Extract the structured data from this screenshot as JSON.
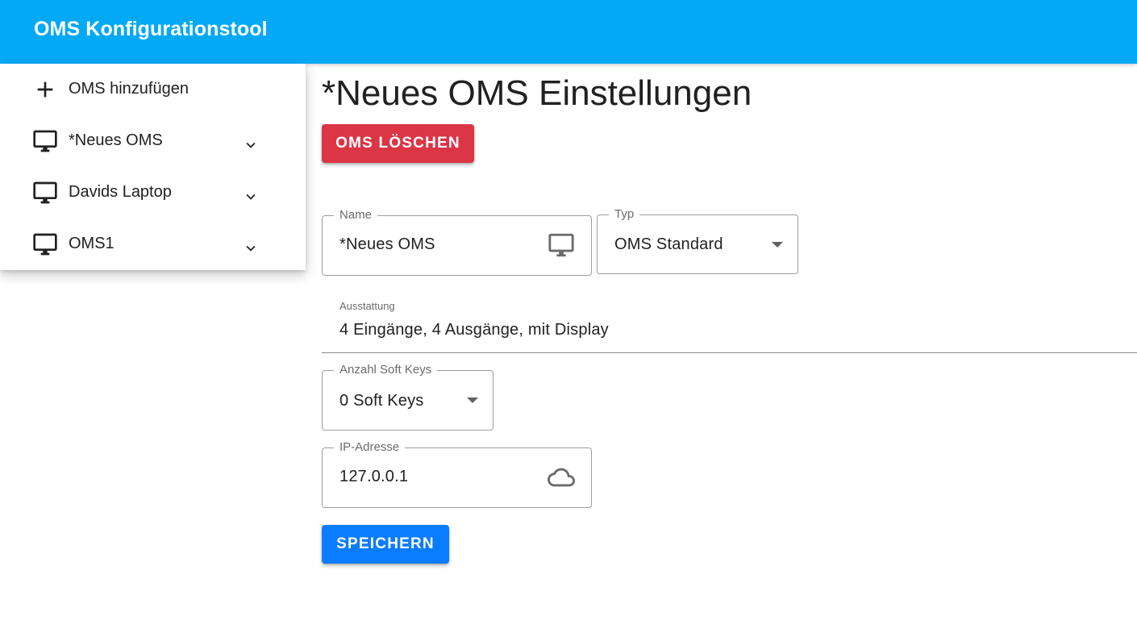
{
  "app": {
    "title": "OMS Konfigurationstool",
    "accent_color": "#03a9f4"
  },
  "sidebar": {
    "add_item": {
      "label": "OMS hinzufügen",
      "icon": "plus-icon"
    },
    "items": [
      {
        "label": "*Neues OMS",
        "icon": "monitor-icon",
        "expand_icon": "chevron-down-icon"
      },
      {
        "label": "Davids Laptop",
        "icon": "monitor-icon",
        "expand_icon": "chevron-down-icon"
      },
      {
        "label": "OMS1",
        "icon": "monitor-icon",
        "expand_icon": "chevron-down-icon"
      }
    ]
  },
  "main": {
    "title": "*Neues OMS Einstellungen",
    "delete_button": {
      "label": "OMS LÖSCHEN",
      "color": "#dc3545"
    },
    "fields": {
      "name": {
        "label": "Name",
        "value": "*Neues OMS",
        "icon": "monitor-icon"
      },
      "typ": {
        "label": "Typ",
        "value": "OMS Standard",
        "icon": "dropdown-arrow-icon"
      },
      "ausstattung": {
        "label": "Ausstattung",
        "value": "4 Eingänge, 4 Ausgänge, mit Display"
      },
      "soft_keys": {
        "label": "Anzahl Soft Keys",
        "value": "0 Soft Keys",
        "icon": "dropdown-arrow-icon"
      },
      "ip": {
        "label": "IP-Adresse",
        "value": "127.0.0.1",
        "icon": "cloud-icon"
      }
    },
    "save_button": {
      "label": "SPEICHERN",
      "color": "#0a7cff"
    }
  }
}
